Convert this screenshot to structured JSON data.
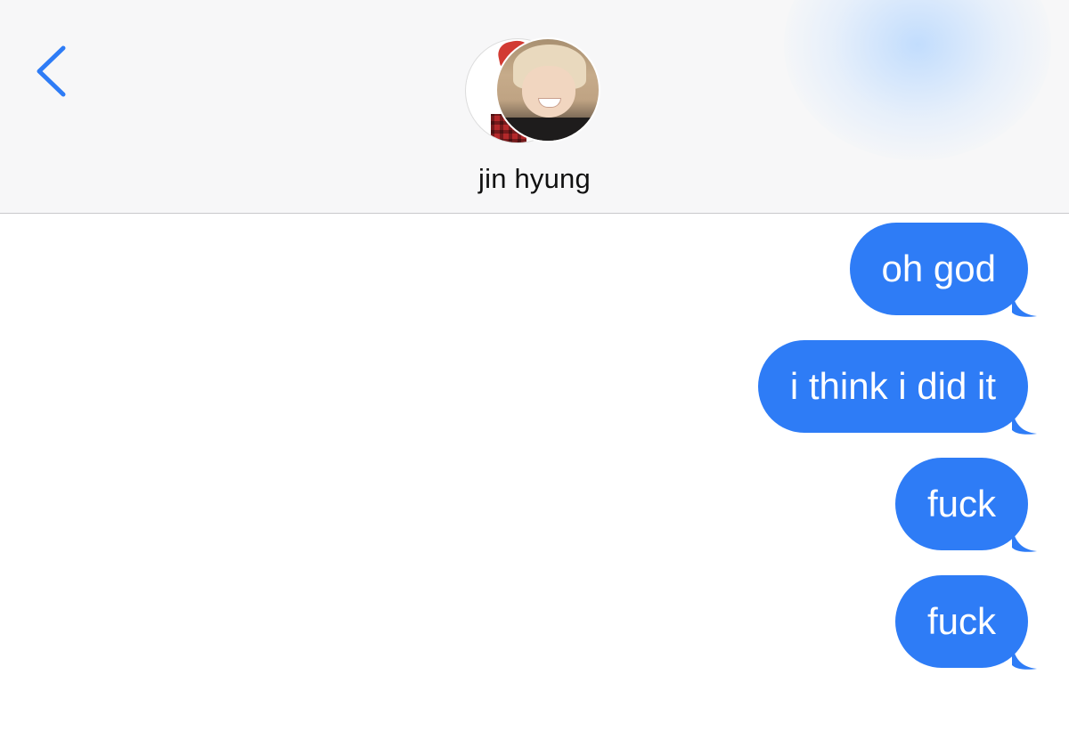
{
  "header": {
    "contact_name": "jin hyung",
    "back_icon": "chevron-left-icon",
    "accent_color": "#2e7cf6"
  },
  "messages": [
    {
      "text": "oh god",
      "direction": "outgoing"
    },
    {
      "text": "i think i did it",
      "direction": "outgoing"
    },
    {
      "text": "fuck",
      "direction": "outgoing"
    },
    {
      "text": "fuck",
      "direction": "outgoing"
    }
  ],
  "colors": {
    "bubble": "#2e7cf6",
    "bubble_text": "#ffffff",
    "header_bg": "#f7f7f8"
  }
}
